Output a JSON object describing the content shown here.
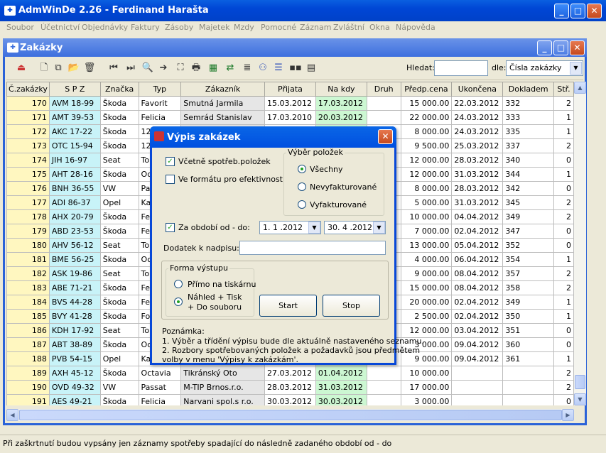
{
  "app": {
    "title": "AdmWinDe 2.26 - Ferdinand Harašta"
  },
  "menu": [
    "Soubor",
    "Účetnictví",
    "Objednávky",
    "Faktury",
    "Zásoby",
    "Majetek",
    "Mzdy",
    "Pomocné",
    "Záznam",
    "Zvláštní",
    "Okna",
    "Nápověda"
  ],
  "child": {
    "title": "Zakázky"
  },
  "toolbar": {
    "search_label": "Hledat:",
    "search_value": "",
    "by_label": "dle:",
    "by_value": "Čísla zakázky"
  },
  "table": {
    "columns": [
      "Č.zakázky",
      "S P Z",
      "Značka",
      "Typ",
      "Zákazník",
      "Přijata",
      "Na kdy",
      "Druh",
      "Předp.cena",
      "Ukončena",
      "Dokladem",
      "Stř."
    ],
    "rows": [
      [
        "170",
        "AVM 18-99",
        "Škoda",
        "Favorit",
        "Smutná Jarmila",
        "15.03.2012",
        "17.03.2012",
        "",
        "15 000.00",
        "22.03.2012",
        "332",
        "2"
      ],
      [
        "171",
        "AMT 39-53",
        "Škoda",
        "Felicia",
        "Semrád Stanislav",
        "17.03.2010",
        "20.03.2012",
        "",
        "22 000.00",
        "24.03.2012",
        "333",
        "1"
      ],
      [
        "172",
        "AKC 17-22",
        "Škoda",
        "120",
        "",
        "",
        "",
        "",
        "8 000.00",
        "24.03.2012",
        "335",
        "1"
      ],
      [
        "173",
        "OTC 15-94",
        "Škoda",
        "120",
        "",
        "",
        "",
        "",
        "9 500.00",
        "25.03.2012",
        "337",
        "2"
      ],
      [
        "174",
        "JIH 16-97",
        "Seat",
        "Tole",
        "",
        "",
        "",
        "",
        "12 000.00",
        "28.03.2012",
        "340",
        "0"
      ],
      [
        "175",
        "AHT 28-16",
        "Škoda",
        "Octa",
        "",
        "",
        "",
        "",
        "12 000.00",
        "31.03.2012",
        "344",
        "1"
      ],
      [
        "176",
        "BNH 36-55",
        "VW",
        "Pass",
        "",
        "",
        "",
        "",
        "8 000.00",
        "28.03.2012",
        "342",
        "0"
      ],
      [
        "177",
        "ADI 86-37",
        "Opel",
        "Kad",
        "",
        "",
        "",
        "",
        "5 000.00",
        "31.03.2012",
        "345",
        "2"
      ],
      [
        "178",
        "AHX 20-79",
        "Škoda",
        "Felic",
        "",
        "",
        "",
        "",
        "10 000.00",
        "04.04.2012",
        "349",
        "2"
      ],
      [
        "179",
        "ABD 23-53",
        "Škoda",
        "Felic",
        "",
        "",
        "",
        "",
        "7 000.00",
        "02.04.2012",
        "347",
        "0"
      ],
      [
        "180",
        "AHV 56-12",
        "Seat",
        "Tole",
        "",
        "",
        "",
        "",
        "13 000.00",
        "05.04.2012",
        "352",
        "0"
      ],
      [
        "181",
        "BME 56-25",
        "Škoda",
        "Octa",
        "",
        "",
        "",
        "",
        "4 000.00",
        "06.04.2012",
        "354",
        "1"
      ],
      [
        "182",
        "ASK 19-86",
        "Seat",
        "Tole",
        "",
        "",
        "",
        "",
        "9 000.00",
        "08.04.2012",
        "357",
        "2"
      ],
      [
        "183",
        "ABE 71-21",
        "Škoda",
        "Felic",
        "",
        "",
        "",
        "",
        "15 000.00",
        "08.04.2012",
        "358",
        "2"
      ],
      [
        "184",
        "BVS 44-28",
        "Škoda",
        "Felic",
        "",
        "",
        "",
        "",
        "20 000.00",
        "02.04.2012",
        "349",
        "1"
      ],
      [
        "185",
        "BVY 41-28",
        "Škoda",
        "Form",
        "",
        "",
        "",
        "",
        "2 500.00",
        "02.04.2012",
        "350",
        "1"
      ],
      [
        "186",
        "KDH 17-92",
        "Seat",
        "Tole",
        "",
        "",
        "",
        "",
        "12 000.00",
        "03.04.2012",
        "351",
        "0"
      ],
      [
        "187",
        "ABT 38-89",
        "Škoda",
        "Octa",
        "",
        "",
        "",
        "",
        "3 000.00",
        "09.04.2012",
        "360",
        "0"
      ],
      [
        "188",
        "PVB 54-15",
        "Opel",
        "Kad",
        "",
        "",
        "",
        "",
        "9 000.00",
        "09.04.2012",
        "361",
        "1"
      ],
      [
        "189",
        "AXH 45-12",
        "Škoda",
        "Octavia",
        "Tikránský Oto",
        "27.03.2012",
        "01.04.2012",
        "",
        "10 000.00",
        "",
        "",
        "2"
      ],
      [
        "190",
        "OVD 49-32",
        "VW",
        "Passat",
        "M-TIP Brnos.r.o.",
        "28.03.2012",
        "31.03.2012",
        "",
        "17 000.00",
        "",
        "",
        "2"
      ],
      [
        "191",
        "AES 49-21",
        "Škoda",
        "Felicia",
        "Narvani spol.s r.o.",
        "30.03.2012",
        "30.03.2012",
        "",
        "3 000.00",
        "",
        "",
        "0"
      ]
    ]
  },
  "status": "Při zaškrtnutí budou vypsány jen záznamy spotřeby spadající do následně zadaného období od - do",
  "dialog": {
    "title": "Výpis zakázek",
    "include_consumption": "Včetně spotřeb.položek",
    "efficiency_format": "Ve formátu pro efektivnost",
    "selection_group": "Výběr položek",
    "opt_all": "Všechny",
    "opt_uninvoiced": "Nevyfakturované",
    "opt_invoiced": "Vyfakturované",
    "period_label": "Za období od - do:",
    "date_from": "1. 1 .2012",
    "date_to": "30. 4 .2012",
    "addition_label": "Dodatek k nadpisu:",
    "addition_value": "",
    "output_group": "Forma výstupu",
    "opt_printer": "Přímo na tiskárnu",
    "opt_preview_1": "Náhled + Tisk",
    "opt_preview_2": "+ Do souboru",
    "start": "Start",
    "stop": "Stop",
    "note_title": "Poznámka:",
    "note_1": "1. Výběr a třídění výpisu bude dle aktuálně nastaveného seznamu.",
    "note_2": "2. Rozbory spotřebovaných položek a požadavků jsou předmětem",
    "note_3": "volby v menu 'Výpisy k zakázkám'."
  }
}
